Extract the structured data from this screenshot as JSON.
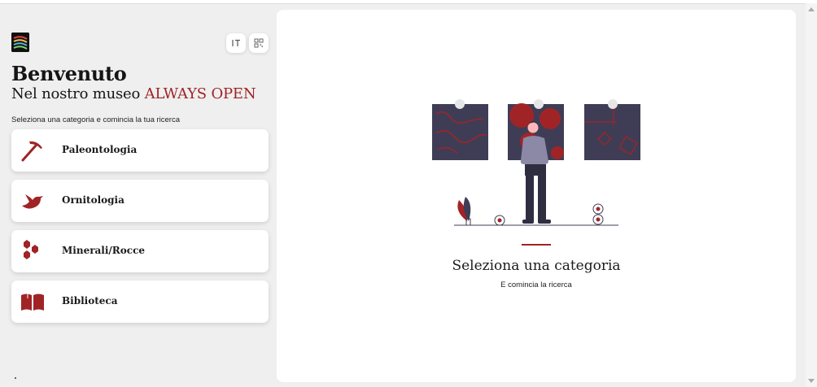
{
  "header": {
    "title": "Benvenuto",
    "subtitle_prefix": "Nel nostro museo ",
    "subtitle_accent": "ALWAYS OPEN",
    "hint": "Seleziona una categoria e comincia la tua ricerca"
  },
  "toolbar": {
    "text_size_icon": "text-size-icon",
    "qr_icon": "qr-code-icon"
  },
  "categories": [
    {
      "label": "Paleontologia",
      "icon": "pickaxe-icon"
    },
    {
      "label": "Ornitologia",
      "icon": "bird-icon"
    },
    {
      "label": "Minerali/Rocce",
      "icon": "hexagons-icon"
    },
    {
      "label": "Biblioteca",
      "icon": "open-book-icon"
    }
  ],
  "empty_state": {
    "title": "Seleziona una categoria",
    "subtitle": "E comincia la ricerca",
    "illustration": "museum-visitor-illustration"
  },
  "colors": {
    "accent": "#a02426",
    "sidebar_bg": "#efefef",
    "panel_bg": "#ffffff",
    "frame_dark": "#3f3d56"
  }
}
